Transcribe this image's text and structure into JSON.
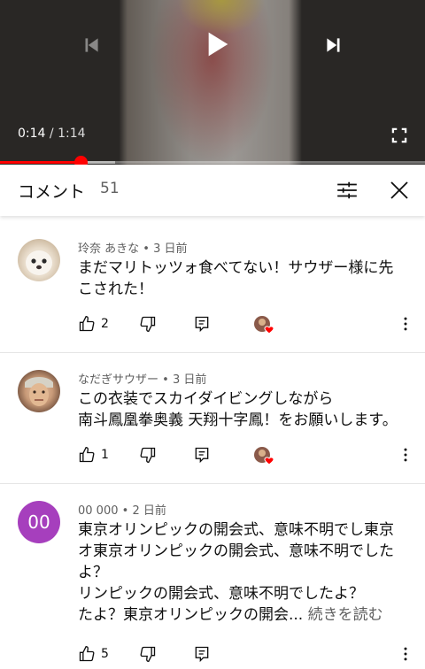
{
  "player": {
    "time_current": "0:14",
    "time_separator": " / ",
    "time_total": "1:14",
    "progress": 0.19,
    "buffered": 0.27
  },
  "comments_header": {
    "title": "コメント",
    "count": "51"
  },
  "comments": [
    {
      "author": "玲奈 あきな",
      "time": "3 日前",
      "lines": [
        "まだマリトッツォ食べてない！サウザー様に先",
        "こされた！"
      ],
      "likes": "2"
    },
    {
      "author": "なだぎサウザー",
      "time": "3 日前",
      "lines": [
        "この衣装でスカイダイビングしながら",
        "南斗鳳凰拳奥義 天翔十字鳳！をお願いします。"
      ],
      "likes": "1"
    },
    {
      "author": "00 000",
      "time": "2 日前",
      "avatar_text": "00",
      "avatar_color": "#a63fbd",
      "lines": [
        "東京オリンピックの開会式、意味不明でし東京",
        "オ東京オリンピックの開会式、意味不明でした",
        "よ？",
        "リンピックの開会式、意味不明でしたよ？",
        "たよ？東京オリンピックの開会..."
      ],
      "read_more": "続きを読む",
      "likes": "5"
    }
  ],
  "meta_separator": " • ",
  "colors": {
    "accent_red": "#ff0000",
    "text_secondary": "#606060"
  }
}
